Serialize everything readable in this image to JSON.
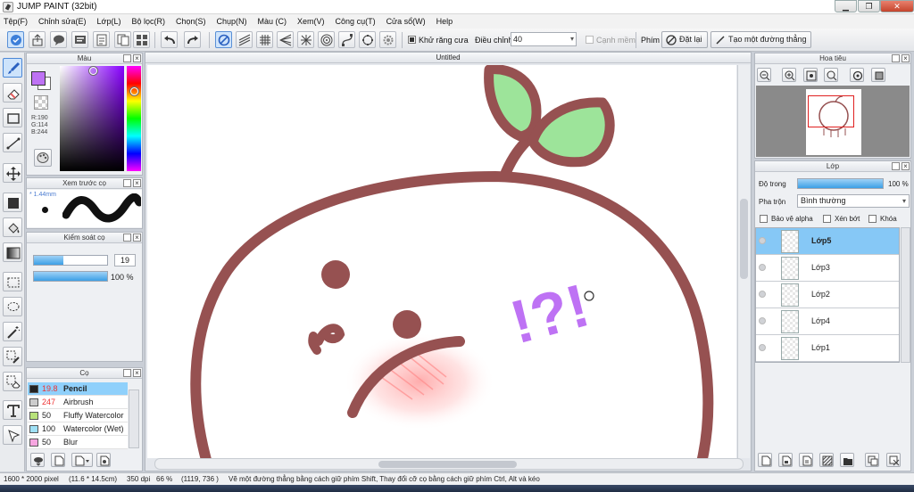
{
  "window": {
    "title": "JUMP PAINT (32bit)",
    "minimize": "▁",
    "maximize": "❐",
    "close": "✕"
  },
  "menu": [
    "Tệp(F)",
    "Chỉnh sửa(E)",
    "Lớp(L)",
    "Bộ lọc(R)",
    "Chọn(S)",
    "Chụp(N)",
    "Màu (C)",
    "Xem(V)",
    "Công cụ(T)",
    "Cửa sổ(W)",
    "Help"
  ],
  "toolbar": {
    "antialias_label": "Khử răng cưa",
    "correction_label": "Điều chỉnh",
    "correction_value": "40",
    "edge_label": "Cạnh mềm",
    "key_label": "Phím",
    "reset_label": "Đặt lại",
    "straight_line_label": "Tạo một đường thẳng"
  },
  "color_panel": {
    "title": "Màu",
    "r": "R:190",
    "g": "G:114",
    "b": "B:244",
    "foreground": "#be72f4"
  },
  "brush_preview": {
    "title": "Xem trước cọ",
    "size": "* 1.44mm"
  },
  "brush_control": {
    "title": "Kiểm soát cọ",
    "size_value": "19",
    "opacity_value": "100 %",
    "size_fraction": 0.4,
    "opacity_fraction": 1.0
  },
  "brush_list": {
    "title": "Cọ",
    "items": [
      {
        "size": "19.8",
        "name": "Pencil",
        "color": "#222222",
        "selected": true
      },
      {
        "size": "247",
        "name": "Airbrush",
        "color": "#cccccc",
        "selected": false
      },
      {
        "size": "50",
        "name": "Fluffy Watercolor",
        "color": "#b8e27a",
        "selected": false
      },
      {
        "size": "100",
        "name": "Watercolor (Wet)",
        "color": "#9fe0f5",
        "selected": false
      },
      {
        "size": "50",
        "name": "Blur",
        "color": "#f7a6e0",
        "selected": false
      }
    ]
  },
  "canvas": {
    "title": "Untitled",
    "text_drawn": "!?!"
  },
  "navigator": {
    "title": "Hoa tiêu"
  },
  "layer_panel": {
    "title": "Lớp",
    "opacity_label": "Độ trong",
    "opacity_value": "100 %",
    "opacity_fraction": 1.0,
    "blend_label": "Pha trộn",
    "blend_value": "Bình thường",
    "protect_alpha": "Bảo vệ alpha",
    "clipping": "Xén bớt",
    "lock": "Khóa",
    "layers": [
      {
        "name": "Lớp5",
        "selected": true
      },
      {
        "name": "Lớp3",
        "selected": false
      },
      {
        "name": "Lớp2",
        "selected": false
      },
      {
        "name": "Lớp4",
        "selected": false
      },
      {
        "name": "Lớp1",
        "selected": false
      }
    ]
  },
  "status": {
    "size": "1600 * 2000 pixel",
    "physical": "(11.6 * 14.5cm)",
    "dpi": "350 dpi",
    "zoom": "66 %",
    "cursor": "(1119, 736 )",
    "hint": "Vẽ một đường thẳng bằng cách giữ phím Shift, Thay đổi cỡ cọ bằng cách giữ phím Ctrl, Alt và kéo"
  }
}
